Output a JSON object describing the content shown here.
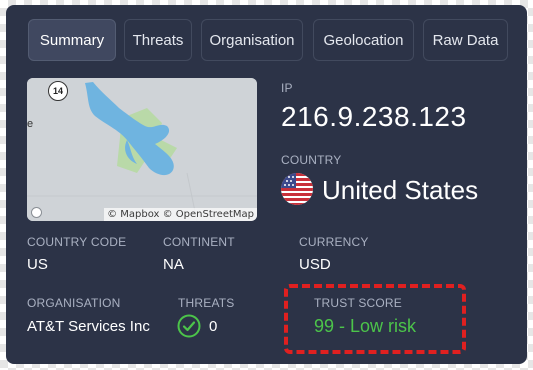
{
  "tabs": [
    {
      "label": "Summary",
      "active": true
    },
    {
      "label": "Threats",
      "active": false
    },
    {
      "label": "Organisation",
      "active": false
    },
    {
      "label": "Geolocation",
      "active": false
    },
    {
      "label": "Raw Data",
      "active": false
    }
  ],
  "map": {
    "route_number": "14",
    "edge_text": "e",
    "credit": "© Mapbox © OpenStreetMap",
    "water_color": "#6fb4e0",
    "land_color": "#cfd3d7",
    "park_color": "#b9d9a8"
  },
  "ip": {
    "label": "IP",
    "value": "216.9.238.123"
  },
  "country": {
    "label": "COUNTRY",
    "value": "United States",
    "flag_icon": "us-flag-icon"
  },
  "country_code": {
    "label": "COUNTRY CODE",
    "value": "US"
  },
  "continent": {
    "label": "CONTINENT",
    "value": "NA"
  },
  "currency": {
    "label": "CURRENCY",
    "value": "USD"
  },
  "organisation": {
    "label": "ORGANISATION",
    "value": "AT&T Services Inc"
  },
  "threats": {
    "label": "THREATS",
    "value": "0",
    "icon": "check-circle-icon",
    "icon_color": "#4cc44a"
  },
  "trust_score": {
    "label": "TRUST SCORE",
    "value": "99 - Low risk",
    "color": "#4cc44a"
  },
  "colors": {
    "card_bg": "#2c3347",
    "highlight": "#e02020"
  }
}
